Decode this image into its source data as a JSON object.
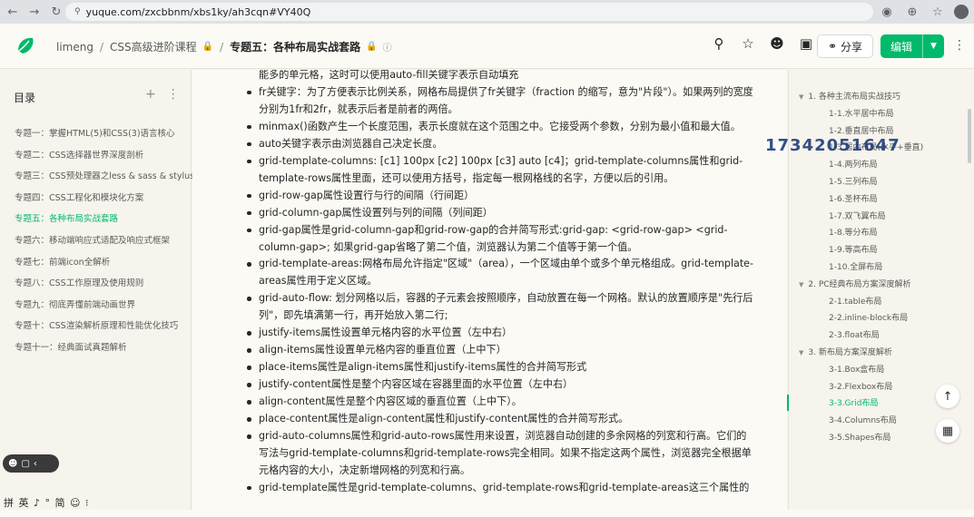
{
  "browser": {
    "url": "yuque.com/zxcbbnm/xbs1ky/ah3cqn#VY40Q"
  },
  "header": {
    "breadcrumb": [
      {
        "label": "limeng"
      },
      {
        "label": "CSS高级进阶课程"
      },
      {
        "label": "专题五：各种布局实战套路"
      }
    ],
    "share_label": "分享",
    "edit_label": "编辑"
  },
  "sidebar": {
    "title": "目录",
    "items": [
      {
        "label": "专题一：掌握HTML(5)和CSS(3)语言核心",
        "active": false
      },
      {
        "label": "专题二：CSS选择器世界深度剖析",
        "active": false
      },
      {
        "label": "专题三：CSS预处理器之less & sass & stylus",
        "active": false
      },
      {
        "label": "专题四：CSS工程化和模块化方案",
        "active": false
      },
      {
        "label": "专题五：各种布局实战套路",
        "active": true
      },
      {
        "label": "专题六：移动端响应式适配及响应式框架",
        "active": false
      },
      {
        "label": "专题七：前端icon全解析",
        "active": false
      },
      {
        "label": "专题八：CSS工作原理及使用规则",
        "active": false
      },
      {
        "label": "专题九：彻底弄懂前端动画世界",
        "active": false
      },
      {
        "label": "专题十：CSS渲染解析原理和性能优化技巧",
        "active": false
      },
      {
        "label": "专题十一：经典面试真题解析",
        "active": false
      }
    ],
    "ime_text": "拼 英 ♪ ° 简 ☺ ⁝"
  },
  "content": {
    "lead": "能多的单元格，这时可以使用auto-fill关键字表示自动填充",
    "bullets": [
      "fr关键字：为了方便表示比例关系，网格布局提供了fr关键字（fraction 的缩写，意为\"片段\"）。如果两列的宽度分别为1fr和2fr，就表示后者是前者的两倍。",
      "minmax()函数产生一个长度范围，表示长度就在这个范围之中。它接受两个参数，分别为最小值和最大值。",
      "auto关键字表示由浏览器自己决定长度。",
      "grid-template-columns: [c1] 100px [c2] 100px [c3] auto [c4]；grid-template-columns属性和grid-template-rows属性里面，还可以使用方括号，指定每一根网格线的名字，方便以后的引用。",
      "grid-row-gap属性设置行与行的间隔（行间距）",
      "grid-column-gap属性设置列与列的间隔（列间距）",
      "grid-gap属性是grid-column-gap和grid-row-gap的合并简写形式:grid-gap: <grid-row-gap> <grid-column-gap>; 如果grid-gap省略了第二个值，浏览器认为第二个值等于第一个值。",
      "grid-template-areas:网格布局允许指定\"区域\"（area），一个区域由单个或多个单元格组成。grid-template-areas属性用于定义区域。",
      " grid-auto-flow: 划分网格以后，容器的子元素会按照顺序，自动放置在每一个网格。默认的放置顺序是\"先行后列\"，即先填满第一行，再开始放入第二行;",
      "justify-items属性设置单元格内容的水平位置（左中右）",
      "align-items属性设置单元格内容的垂直位置（上中下）",
      "place-items属性是align-items属性和justify-items属性的合并简写形式",
      "justify-content属性是整个内容区域在容器里面的水平位置（左中右）",
      "align-content属性是整个内容区域的垂直位置（上中下）。",
      "place-content属性是align-content属性和justify-content属性的合并简写形式。",
      "grid-auto-columns属性和grid-auto-rows属性用来设置，浏览器自动创建的多余网格的列宽和行高。它们的写法与grid-template-columns和grid-template-rows完全相同。如果不指定这两个属性，浏览器完全根据单元格内容的大小，决定新增网格的列宽和行高。",
      "grid-template属性是grid-template-columns、grid-template-rows和grid-template-areas这三个属性的"
    ]
  },
  "toc": {
    "items": [
      {
        "label": "1. 各种主流布局实战技巧",
        "level": 1,
        "active": false
      },
      {
        "label": "1-1.水平居中布局",
        "level": 2,
        "active": false
      },
      {
        "label": "1-2.垂直居中布局",
        "level": 2,
        "active": false
      },
      {
        "label": "1-3.居中布局(水平+垂直)",
        "level": 2,
        "active": false
      },
      {
        "label": "1-4.两列布局",
        "level": 2,
        "active": false
      },
      {
        "label": "1-5.三列布局",
        "level": 2,
        "active": false
      },
      {
        "label": "1-6.圣杯布局",
        "level": 2,
        "active": false
      },
      {
        "label": "1-7.双飞翼布局",
        "level": 2,
        "active": false
      },
      {
        "label": "1-8.等分布局",
        "level": 2,
        "active": false
      },
      {
        "label": "1-9.等高布局",
        "level": 2,
        "active": false
      },
      {
        "label": "1-10.全屏布局",
        "level": 2,
        "active": false
      },
      {
        "label": "2. PC经典布局方案深度解析",
        "level": 1,
        "active": false
      },
      {
        "label": "2-1.table布局",
        "level": 2,
        "active": false
      },
      {
        "label": "2-2.inline-block布局",
        "level": 2,
        "active": false
      },
      {
        "label": "2-3.float布局",
        "level": 2,
        "active": false
      },
      {
        "label": "3. 新布局方案深度解析",
        "level": 1,
        "active": false
      },
      {
        "label": "3-1.Box盒布局",
        "level": 2,
        "active": false
      },
      {
        "label": "3-2.Flexbox布局",
        "level": 2,
        "active": false
      },
      {
        "label": "3-3.Grid布局",
        "level": 2,
        "active": true
      },
      {
        "label": "3-4.Columns布局",
        "level": 2,
        "active": false
      },
      {
        "label": "3-5.Shapes布局",
        "level": 2,
        "active": false
      }
    ]
  },
  "watermark": "17342051647",
  "colors": {
    "accent": "#00b96b",
    "watermark": "#1f3d7a"
  }
}
